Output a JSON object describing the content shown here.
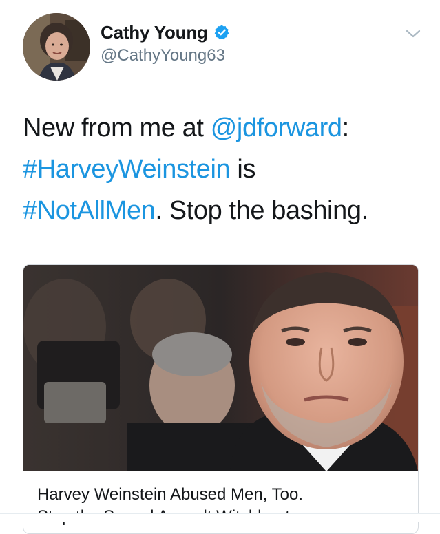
{
  "author": {
    "display_name": "Cathy Young",
    "handle": "@CathyYoung63",
    "verified": true
  },
  "tweet": {
    "segments": [
      {
        "text": "New from me at ",
        "type": "text"
      },
      {
        "text": "@jdforward",
        "type": "mention"
      },
      {
        "text": ":",
        "type": "text"
      },
      {
        "text": "#HarveyWeinstein",
        "type": "hashtag"
      },
      {
        "text": " is",
        "type": "text"
      },
      {
        "text": "#NotAllMen",
        "type": "hashtag"
      },
      {
        "text": ". Stop the bashing.",
        "type": "text"
      }
    ]
  },
  "card": {
    "title": "Harvey Weinstein Abused Men, Too.",
    "subtitle": "Stop the Sexual Assault Witchhunt"
  },
  "icons": {
    "verified": "verified-badge-icon",
    "caret": "chevron-down-icon"
  },
  "colors": {
    "link": "#1b95e0",
    "verified": "#1da1f2",
    "secondary_text": "#657786"
  }
}
